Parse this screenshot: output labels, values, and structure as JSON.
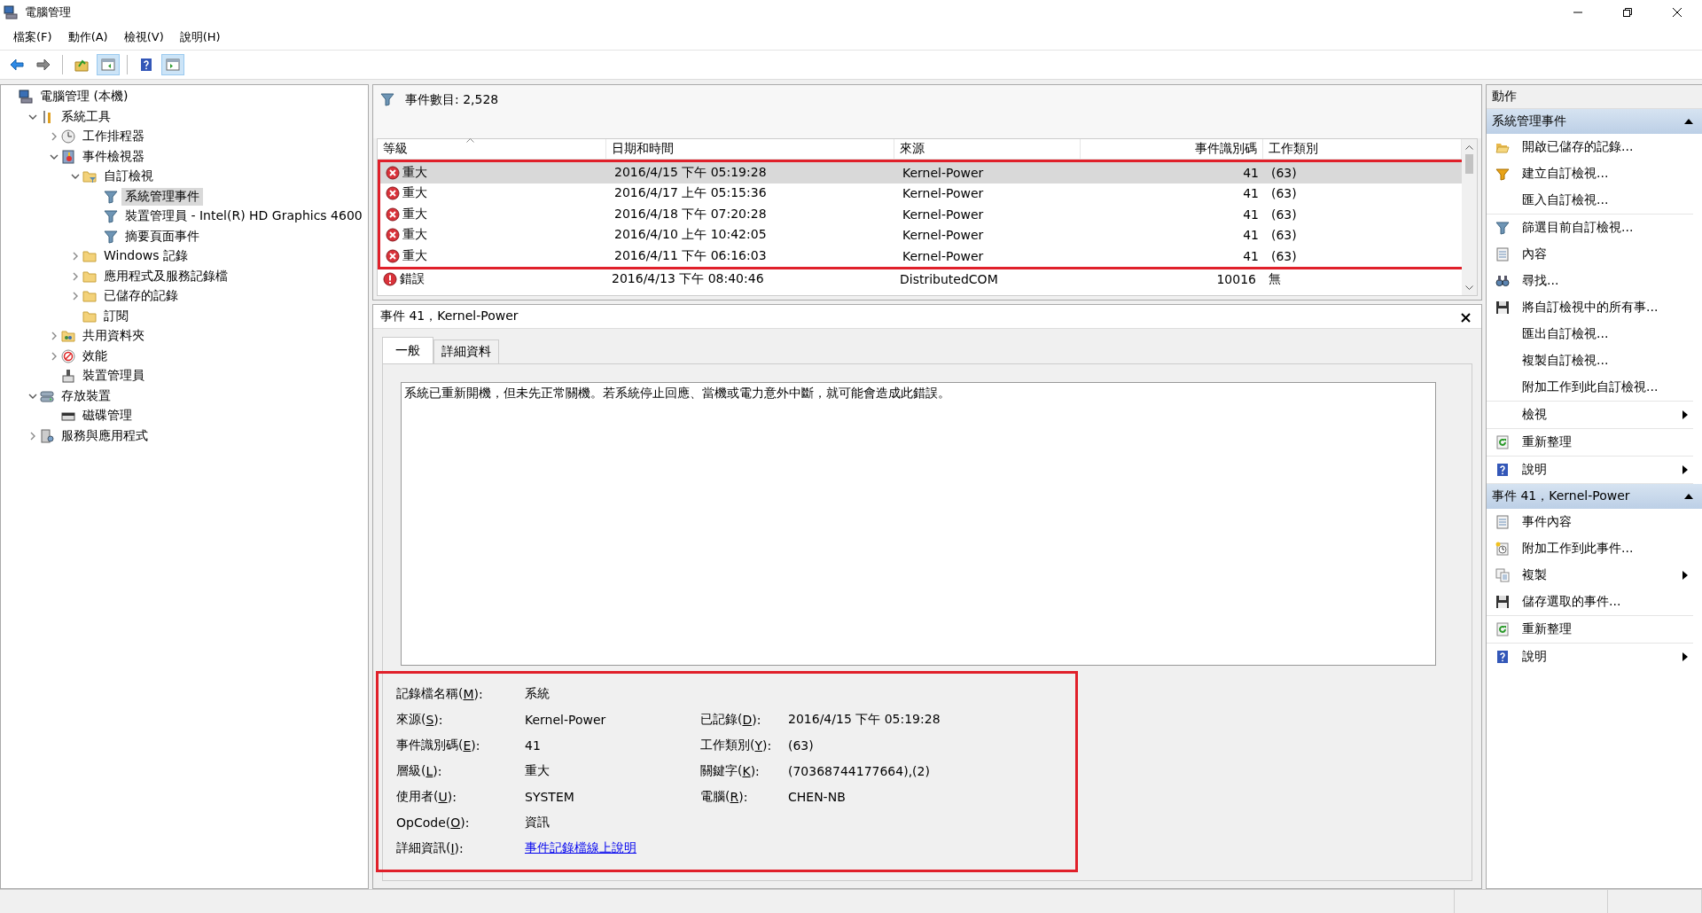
{
  "window": {
    "title": "電腦管理"
  },
  "menu": [
    "檔案(F)",
    "動作(A)",
    "檢視(V)",
    "說明(H)"
  ],
  "toolbar": [
    [
      {
        "kind": "back",
        "pressed": false
      },
      {
        "kind": "forward",
        "pressed": false
      }
    ],
    [
      {
        "kind": "up",
        "pressed": false
      },
      {
        "kind": "tree-pane",
        "pressed": true
      }
    ],
    [
      {
        "kind": "help",
        "pressed": false
      },
      {
        "kind": "action-pane",
        "pressed": true
      }
    ]
  ],
  "tree": [
    {
      "label": "電腦管理 (本機)",
      "kind": "computer",
      "selected": false,
      "children": [
        {
          "label": "系統工具",
          "kind": "tools",
          "selected": false,
          "expanded": true,
          "children": [
            {
              "label": "工作排程器",
              "kind": "clock",
              "selected": false,
              "expanded": false
            },
            {
              "label": "事件檢視器",
              "kind": "eventlog",
              "selected": false,
              "expanded": true,
              "children": [
                {
                  "label": "自訂檢視",
                  "kind": "folder-filter",
                  "selected": false,
                  "expanded": true,
                  "children": [
                    {
                      "label": "系統管理事件",
                      "kind": "filter",
                      "selected": true
                    },
                    {
                      "label": "裝置管理員 - Intel(R) HD Graphics 4600",
                      "kind": "filter",
                      "selected": false
                    },
                    {
                      "label": "摘要頁面事件",
                      "kind": "filter",
                      "selected": false
                    }
                  ]
                },
                {
                  "label": "Windows 記錄",
                  "kind": "folder",
                  "selected": false,
                  "expanded": false
                },
                {
                  "label": "應用程式及服務記錄檔",
                  "kind": "folder",
                  "selected": false,
                  "expanded": false
                },
                {
                  "label": "已儲存的記錄",
                  "kind": "folder",
                  "selected": false,
                  "expanded": false
                },
                {
                  "label": "訂閱",
                  "kind": "folder",
                  "selected": false
                }
              ]
            },
            {
              "label": "共用資料夾",
              "kind": "share",
              "selected": false,
              "expanded": false
            },
            {
              "label": "效能",
              "kind": "perf",
              "selected": false,
              "expanded": false
            },
            {
              "label": "裝置管理員",
              "kind": "device",
              "selected": false
            }
          ]
        },
        {
          "label": "存放裝置",
          "kind": "storage",
          "selected": false,
          "expanded": true,
          "children": [
            {
              "label": "磁碟管理",
              "kind": "disk",
              "selected": false
            }
          ]
        },
        {
          "label": "服務與應用程式",
          "kind": "services",
          "selected": false,
          "expanded": false
        }
      ]
    }
  ],
  "event_list": {
    "count": "事件數目: 2,528",
    "columns": [
      "等級",
      "日期和時間",
      "來源",
      "事件識別碼",
      "工作類別"
    ],
    "rows": [
      {
        "kind": "critical",
        "level_text": "重大",
        "date": "2016/4/15 下午 05:19:28",
        "source": "Kernel-Power",
        "event_id": "41",
        "category": "(63)",
        "selected": true,
        "highlighted": true
      },
      {
        "kind": "critical",
        "level_text": "重大",
        "date": "2016/4/17 上午 05:15:36",
        "source": "Kernel-Power",
        "event_id": "41",
        "category": "(63)",
        "selected": false,
        "highlighted": true
      },
      {
        "kind": "critical",
        "level_text": "重大",
        "date": "2016/4/18 下午 07:20:28",
        "source": "Kernel-Power",
        "event_id": "41",
        "category": "(63)",
        "selected": false,
        "highlighted": true
      },
      {
        "kind": "critical",
        "level_text": "重大",
        "date": "2016/4/10 上午 10:42:05",
        "source": "Kernel-Power",
        "event_id": "41",
        "category": "(63)",
        "selected": false,
        "highlighted": true
      },
      {
        "kind": "critical",
        "level_text": "重大",
        "date": "2016/4/11 下午 06:16:03",
        "source": "Kernel-Power",
        "event_id": "41",
        "category": "(63)",
        "selected": false,
        "highlighted": true
      },
      {
        "kind": "error",
        "level_text": "錯誤",
        "date": "2016/4/13 下午 08:40:46",
        "source": "DistributedCOM",
        "event_id": "10016",
        "category": "無",
        "selected": false,
        "highlighted": false
      }
    ]
  },
  "event_detail": {
    "title": "事件 41，Kernel-Power",
    "tabs": [
      {
        "label": "一般",
        "selected": true
      },
      {
        "label": "詳細資料",
        "selected": false
      }
    ],
    "description": "系統已重新開機，但未先正常關機。若系統停止回應、當機或電力意外中斷，就可能會造成此錯誤。",
    "highlighted": true,
    "rows": [
      {
        "left": {
          "label": "記錄檔名稱(M):",
          "value": "系統"
        }
      },
      {
        "left": {
          "label": "來源(S):",
          "value": "Kernel-Power"
        },
        "right": {
          "label": "已記錄(D):",
          "value": "2016/4/15 下午 05:19:28"
        }
      },
      {
        "left": {
          "label": "事件識別碼(E):",
          "value": "41"
        },
        "right": {
          "label": "工作類別(Y):",
          "value": "(63)"
        }
      },
      {
        "left": {
          "label": "層級(L):",
          "value": "重大"
        },
        "right": {
          "label": "關鍵字(K):",
          "value": "(70368744177664),(2)"
        }
      },
      {
        "left": {
          "label": "使用者(U):",
          "value": "SYSTEM"
        },
        "right": {
          "label": "電腦(R):",
          "value": "CHEN-NB"
        }
      },
      {
        "left": {
          "label": "OpCode(O):",
          "value": "資訊"
        }
      },
      {
        "left": {
          "label": "詳細資訊(I):",
          "value": "事件記錄檔線上說明",
          "kind": "link"
        }
      }
    ]
  },
  "actions": {
    "title": "動作",
    "sections": [
      {
        "title": "系統管理事件",
        "expanded": true,
        "groups": [
          [
            {
              "label": "開啟已儲存的記錄...",
              "kind": "open-folder",
              "submenu": false
            },
            {
              "label": "建立自訂檢視...",
              "kind": "filter-new",
              "submenu": false
            },
            {
              "label": "匯入自訂檢視...",
              "kind": "plain",
              "submenu": false
            }
          ],
          [
            {
              "label": "篩選目前自訂檢視...",
              "kind": "filter",
              "submenu": false
            },
            {
              "label": "內容",
              "kind": "properties",
              "submenu": false
            },
            {
              "label": "尋找...",
              "kind": "find",
              "submenu": false
            },
            {
              "label": "將自訂檢視中的所有事...",
              "kind": "save",
              "submenu": false
            },
            {
              "label": "匯出自訂檢視...",
              "kind": "plain",
              "submenu": false
            },
            {
              "label": "複製自訂檢視...",
              "kind": "plain",
              "submenu": false
            },
            {
              "label": "附加工作到此自訂檢視...",
              "kind": "plain",
              "submenu": false
            }
          ],
          [
            {
              "label": "檢視",
              "kind": "plain",
              "submenu": true
            }
          ],
          [
            {
              "label": "重新整理",
              "kind": "refresh",
              "submenu": false
            }
          ],
          [
            {
              "label": "說明",
              "kind": "help",
              "submenu": true
            }
          ]
        ]
      },
      {
        "title": "事件 41，Kernel-Power",
        "expanded": true,
        "groups": [
          [
            {
              "label": "事件內容",
              "kind": "properties",
              "submenu": false
            },
            {
              "label": "附加工作到此事件...",
              "kind": "task",
              "submenu": false
            },
            {
              "label": "複製",
              "kind": "copy",
              "submenu": true
            },
            {
              "label": "儲存選取的事件...",
              "kind": "save",
              "submenu": false
            }
          ],
          [
            {
              "label": "重新整理",
              "kind": "refresh",
              "submenu": false
            }
          ],
          [
            {
              "label": "說明",
              "kind": "help",
              "submenu": true
            }
          ]
        ]
      }
    ]
  }
}
